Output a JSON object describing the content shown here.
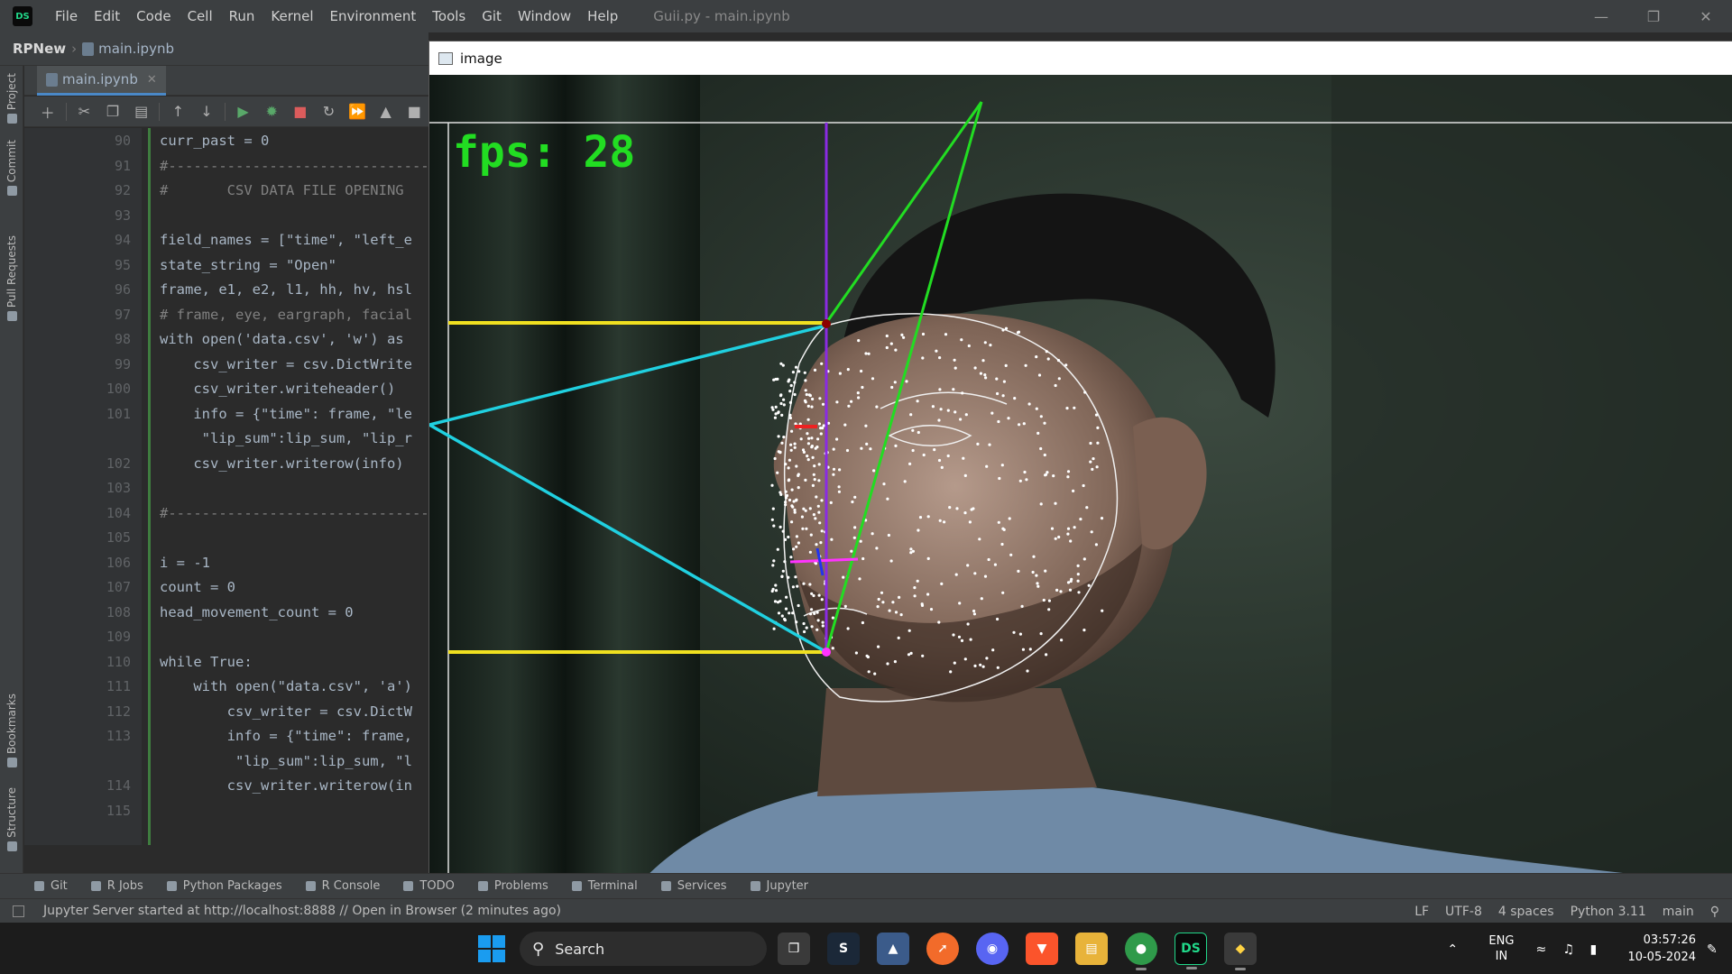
{
  "titlebar": {
    "logo_text": "DS",
    "menu": [
      "File",
      "Edit",
      "Code",
      "Cell",
      "Run",
      "Kernel",
      "Environment",
      "Tools",
      "Git",
      "Window",
      "Help"
    ],
    "window_title": "Guii.py - main.ipynb"
  },
  "breadcrumb": {
    "project": "RPNew",
    "file": "main.ipynb"
  },
  "left_tools": {
    "project": "Project",
    "commit": "Commit",
    "pull_requests": "Pull Requests",
    "bookmarks": "Bookmarks",
    "structure": "Structure"
  },
  "editor": {
    "tab_label": "main.ipynb",
    "lines": [
      {
        "no": "90",
        "code": "curr_past = 0"
      },
      {
        "no": "91",
        "code": "#--------------------------------"
      },
      {
        "no": "92",
        "code": "#       CSV DATA FILE OPENING"
      },
      {
        "no": "93",
        "code": ""
      },
      {
        "no": "94",
        "code": "field_names = [\"time\", \"left_e"
      },
      {
        "no": "95",
        "code": "state_string = \"Open\""
      },
      {
        "no": "96",
        "code": "frame, e1, e2, l1, hh, hv, hsl"
      },
      {
        "no": "97",
        "code": "# frame, eye, eargraph, facial"
      },
      {
        "no": "98",
        "code": "with open('data.csv', 'w') as"
      },
      {
        "no": "99",
        "code": "    csv_writer = csv.DictWrite"
      },
      {
        "no": "100",
        "code": "    csv_writer.writeheader()"
      },
      {
        "no": "101",
        "code": "    info = {\"time\": frame, \"le"
      },
      {
        "no": "",
        "code": "     \"lip_sum\":lip_sum, \"lip_r"
      },
      {
        "no": "102",
        "code": "    csv_writer.writerow(info)"
      },
      {
        "no": "103",
        "code": ""
      },
      {
        "no": "104",
        "code": "#--------------------------------"
      },
      {
        "no": "105",
        "code": ""
      },
      {
        "no": "106",
        "code": "i = -1"
      },
      {
        "no": "107",
        "code": "count = 0"
      },
      {
        "no": "108",
        "code": "head_movement_count = 0"
      },
      {
        "no": "109",
        "code": ""
      },
      {
        "no": "110",
        "code": "while True:"
      },
      {
        "no": "111",
        "code": "    with open(\"data.csv\", 'a')"
      },
      {
        "no": "112",
        "code": "        csv_writer = csv.DictW"
      },
      {
        "no": "113",
        "code": "        info = {\"time\": frame,"
      },
      {
        "no": "",
        "code": "         \"lip_sum\":lip_sum, \"l"
      },
      {
        "no": "114",
        "code": "        csv_writer.writerow(in"
      },
      {
        "no": "115",
        "code": ""
      }
    ]
  },
  "image_window": {
    "title": "image",
    "fps_text": "fps: 28"
  },
  "bottom_tabs": [
    "Git",
    "R Jobs",
    "Python Packages",
    "R Console",
    "TODO",
    "Problems",
    "Terminal",
    "Services",
    "Jupyter"
  ],
  "status": {
    "message": "Jupyter Server started at http://localhost:8888 // Open in Browser (2 minutes ago)",
    "line_sep": "LF",
    "encoding": "UTF-8",
    "indent": "4 spaces",
    "interpreter": "Python 3.11",
    "branch": "main"
  },
  "taskbar": {
    "search_placeholder": "Search",
    "lang_top": "ENG",
    "lang_bottom": "IN",
    "time": "03:57:26",
    "date": "10-05-2024"
  },
  "colors": {
    "accent": "#4a88c7",
    "ide_bg": "#2b2b2b",
    "taskbar_bg": "#1c1c1c"
  }
}
